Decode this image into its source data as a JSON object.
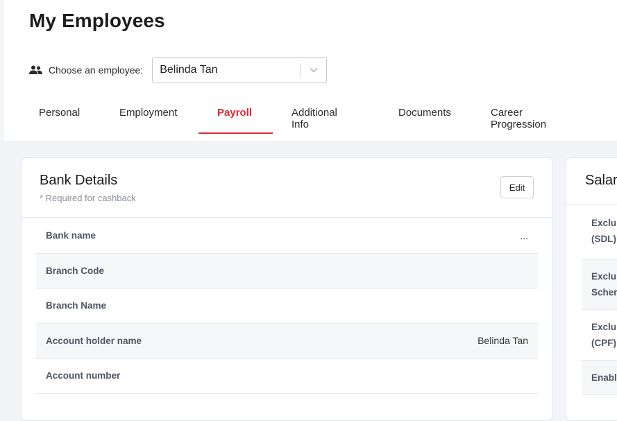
{
  "page": {
    "title": "My Employees",
    "chooser_label": "Choose an employee:",
    "selected_employee": "Belinda Tan"
  },
  "tabs": [
    {
      "label": "Personal",
      "active": false
    },
    {
      "label": "Employment",
      "active": false
    },
    {
      "label": "Payroll",
      "active": true
    },
    {
      "label": "Additional Info",
      "active": false
    },
    {
      "label": "Documents",
      "active": false
    },
    {
      "label": "Career Progression",
      "active": false
    }
  ],
  "bank": {
    "title": "Bank Details",
    "subtitle": "* Required for cashback",
    "edit_label": "Edit",
    "rows": [
      {
        "label": "Bank name",
        "value": "..."
      },
      {
        "label": "Branch Code",
        "value": ""
      },
      {
        "label": "Branch Name",
        "value": ""
      },
      {
        "label": "Account holder name",
        "value": "Belinda Tan"
      },
      {
        "label": "Account number",
        "value": ""
      }
    ]
  },
  "salary": {
    "title": "Salar",
    "rows": [
      {
        "line1": "Exclu",
        "line2": "(SDL)"
      },
      {
        "line1": "Exclu",
        "line2": "Scher"
      },
      {
        "line1": "Exclu",
        "line2": "(CPF)"
      },
      {
        "line1": "Enabl",
        "line2": ""
      }
    ]
  },
  "colors": {
    "accent": "#e32636",
    "background": "#f3f4f7"
  }
}
